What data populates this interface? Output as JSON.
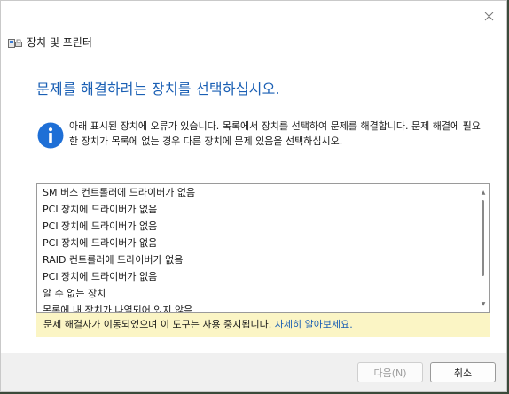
{
  "window": {
    "title": "장치 및 프린터",
    "close_icon": "close-icon"
  },
  "main": {
    "heading": "문제를 해결하려는 장치를 선택하십시오.",
    "info_text": "아래 표시된 장치에 오류가 있습니다. 목록에서 장치를 선택하여 문제를 해결합니다. 문제 해결에 필요한 장치가 목록에 없는 경우 다른 장치에 문제 있음을 선택하십시오.",
    "info_icon": "info-icon"
  },
  "device_list": {
    "items": [
      "SM 버스 컨트롤러에 드라이버가 없음",
      "PCI 장치에 드라이버가 없음",
      "PCI 장치에 드라이버가 없음",
      "PCI 장치에 드라이버가 없음",
      "RAID 컨트롤러에 드라이버가 없음",
      "PCI 장치에 드라이버가 없음",
      "알 수 없는 장치",
      "목록에 내 장치가 나열되어 있지 않음"
    ]
  },
  "notice": {
    "text": "문제 해결사가 이동되었으며 이 도구는 사용 중지됩니다. ",
    "link": "자세히 알아보세요."
  },
  "footer": {
    "next_label": "다음(N)",
    "cancel_label": "취소"
  },
  "colors": {
    "accent": "#1a5fb4",
    "notice_bg": "#fbf5c5"
  }
}
